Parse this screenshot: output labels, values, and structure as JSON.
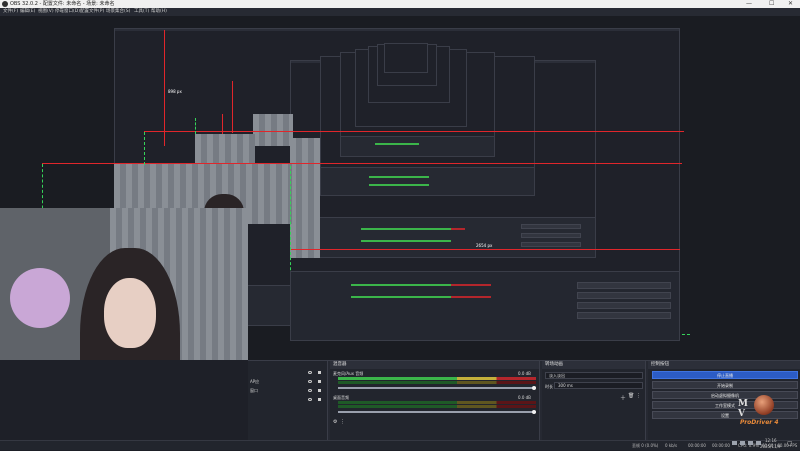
{
  "window": {
    "title": "OBS 32.0.2 - 配置文件: 未命名 - 场景: 未命名",
    "controls": {
      "minimize": "—",
      "maximize": "☐",
      "close": "✕"
    }
  },
  "menu": [
    "文件(F)",
    "编辑(E)",
    "视图(V)",
    "停靠窗口(D)",
    "配置文件(P)",
    "场景集合(S)",
    "工具(T)",
    "帮助(H)"
  ],
  "preview": {
    "measure_labels": [
      "898 px",
      "2654 px"
    ]
  },
  "sources": {
    "items": [
      "AP应",
      "窗口"
    ]
  },
  "mixer": {
    "title": "混音器",
    "channels": [
      {
        "name": "麦克风/Aux 音频",
        "db": "0.0 dB"
      },
      {
        "name": "桌面音频",
        "db": "0.0 dB"
      }
    ]
  },
  "transitions": {
    "title": "转场动画",
    "type": "淡入淡出",
    "duration_label": "时长",
    "duration": "300 ms"
  },
  "controls": {
    "title": "控制按钮",
    "buttons": [
      "停止直播",
      "开始录制",
      "启动虚拟摄像机",
      "工作室模式",
      "设置"
    ]
  },
  "status": {
    "dropped": "丢帧 0 (0.0%)",
    "bitrate": "0 kb/s",
    "live_time": "00:00:00",
    "rec_time": "00:00:00",
    "cpu": "CPU: 0.9%",
    "fps": "60.00 / 60.00 FPS"
  },
  "clock": {
    "time": "12:16",
    "date": "2025/11/9"
  },
  "watermark": {
    "letters": "M V",
    "text": "ProDriver 4"
  },
  "colors": {
    "accent": "#2c5cc5",
    "guide_red": "#e0262b",
    "guide_green": "#35d35a",
    "meter_green": "#3bb54a"
  }
}
